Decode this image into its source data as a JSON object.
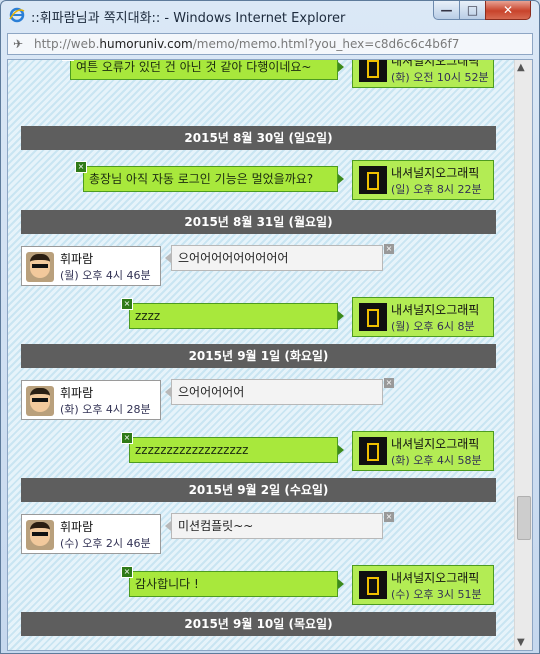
{
  "window": {
    "title": "::휘파람님과 쪽지대화:: - Windows Internet Explorer",
    "btn_min": "—",
    "btn_max": "□",
    "btn_close": "✕"
  },
  "address": {
    "prefix": "http://web.",
    "domain": "humoruniv.com",
    "suffix": "/memo/memo.html?you_hex=c8d6c6c4b6f7"
  },
  "me": {
    "name": "내셔널지오그래픽"
  },
  "other": {
    "name": "휘파람"
  },
  "close_glyph": "×",
  "messages": [
    {
      "kind": "sent",
      "text": "여튼 오류가 있던 건 아닌 것 같아 다행이네요~",
      "time": "(화) 오전 10시 52분"
    },
    {
      "kind": "date",
      "text": "2015년 8월 30일 (일요일)"
    },
    {
      "kind": "sent",
      "text": "총장님 아직 자동 로그인 기능은 멀었을까요?",
      "time": "(일) 오후 8시 22분"
    },
    {
      "kind": "date",
      "text": "2015년 8월 31일 (월요일)"
    },
    {
      "kind": "recv",
      "text": "으어어어어어어어어어",
      "time": "(월) 오후 4시 46분"
    },
    {
      "kind": "sent",
      "text": "zzzz",
      "time": "(월) 오후 6시 8분"
    },
    {
      "kind": "date",
      "text": "2015년 9월 1일 (화요일)"
    },
    {
      "kind": "recv",
      "text": "으어어어어어",
      "time": "(화) 오후 4시 28분"
    },
    {
      "kind": "sent",
      "text": "zzzzzzzzzzzzzzzzzz",
      "time": "(화) 오후 4시 58분"
    },
    {
      "kind": "date",
      "text": "2015년 9월 2일 (수요일)"
    },
    {
      "kind": "recv",
      "text": "미션컴플릿~~",
      "time": "(수) 오후 2시 46분"
    },
    {
      "kind": "sent",
      "text": "감사합니다 !",
      "time": "(수) 오후 3시 51분"
    },
    {
      "kind": "date",
      "text": "2015년 9월 10일 (목요일)"
    }
  ]
}
